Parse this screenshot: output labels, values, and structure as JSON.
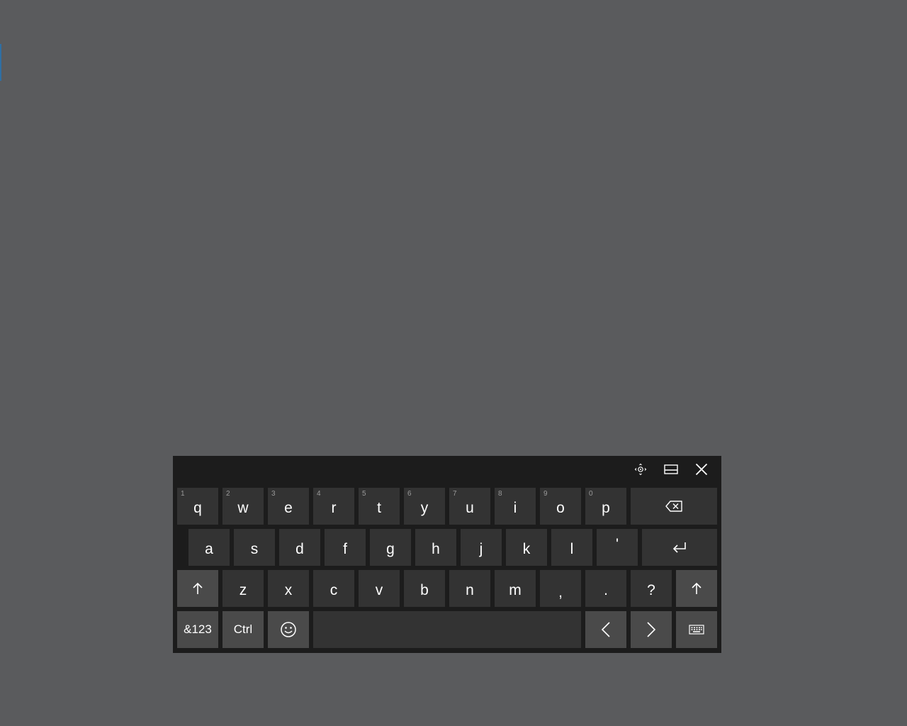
{
  "titlebar": {
    "move_icon": "move-handle-icon",
    "dock_icon": "dock-icon",
    "close_icon": "close-icon"
  },
  "rows": {
    "row1": {
      "keys": [
        {
          "label": "q",
          "hint": "1"
        },
        {
          "label": "w",
          "hint": "2"
        },
        {
          "label": "e",
          "hint": "3"
        },
        {
          "label": "r",
          "hint": "4"
        },
        {
          "label": "t",
          "hint": "5"
        },
        {
          "label": "y",
          "hint": "6"
        },
        {
          "label": "u",
          "hint": "7"
        },
        {
          "label": "i",
          "hint": "8"
        },
        {
          "label": "o",
          "hint": "9"
        },
        {
          "label": "p",
          "hint": "0"
        }
      ],
      "backspace_icon": "backspace-icon"
    },
    "row2": {
      "keys": [
        "a",
        "s",
        "d",
        "f",
        "g",
        "h",
        "j",
        "k",
        "l",
        "'"
      ],
      "enter_icon": "enter-icon"
    },
    "row3": {
      "shift_icon": "shift-arrow-icon",
      "keys": [
        "z",
        "x",
        "c",
        "v",
        "b",
        "n",
        "m",
        ",",
        ".",
        "?"
      ]
    },
    "row4": {
      "symbols_label": "&123",
      "ctrl_label": "Ctrl",
      "emoji_icon": "emoji-icon",
      "left_icon": "chevron-left-icon",
      "right_icon": "chevron-right-icon",
      "layout_icon": "keyboard-icon"
    }
  },
  "colors": {
    "desktop": "#5a5b5d",
    "panel": "#1c1c1c",
    "key": "#333333",
    "key_alt": "#4a4a4a",
    "text": "#ffffff",
    "hint": "#9a9a9a"
  }
}
